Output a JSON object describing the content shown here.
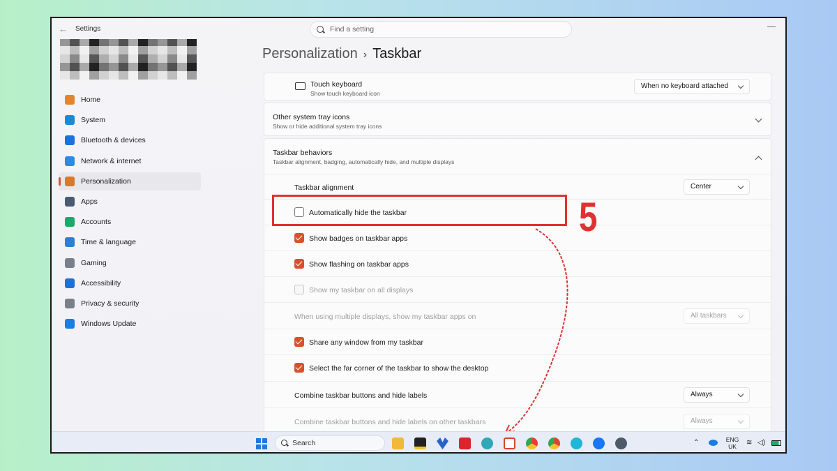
{
  "window": {
    "app_title": "Settings",
    "search_placeholder": "Find a setting",
    "breadcrumb_parent": "Personalization",
    "breadcrumb_sep": "›",
    "breadcrumb_current": "Taskbar"
  },
  "sidebar": {
    "items": [
      {
        "label": "Home",
        "icon": "home-icon",
        "color": "#e2852f"
      },
      {
        "label": "System",
        "icon": "system-icon",
        "color": "#1b8ad6"
      },
      {
        "label": "Bluetooth & devices",
        "icon": "bluetooth-icon",
        "color": "#1a73d8"
      },
      {
        "label": "Network & internet",
        "icon": "wifi-icon",
        "color": "#2a8be0"
      },
      {
        "label": "Personalization",
        "icon": "brush-icon",
        "color": "#d87a2a"
      },
      {
        "label": "Apps",
        "icon": "apps-icon",
        "color": "#4a5a73"
      },
      {
        "label": "Accounts",
        "icon": "person-icon",
        "color": "#1da96b"
      },
      {
        "label": "Time & language",
        "icon": "globe-clock-icon",
        "color": "#2b7fd4"
      },
      {
        "label": "Gaming",
        "icon": "gamepad-icon",
        "color": "#7a7f8a"
      },
      {
        "label": "Accessibility",
        "icon": "accessibility-icon",
        "color": "#1e72d6"
      },
      {
        "label": "Privacy & security",
        "icon": "shield-icon",
        "color": "#7a8089"
      },
      {
        "label": "Windows Update",
        "icon": "update-icon",
        "color": "#1a7de0"
      }
    ]
  },
  "settings": {
    "touch_keyboard": {
      "title": "Touch keyboard",
      "subtitle": "Show touch keyboard icon",
      "value": "When no keyboard attached"
    },
    "other_tray": {
      "title": "Other system tray icons",
      "subtitle": "Show or hide additional system tray icons"
    },
    "behaviors": {
      "title": "Taskbar behaviors",
      "subtitle": "Taskbar alignment, badging, automatically hide, and multiple displays",
      "alignment_label": "Taskbar alignment",
      "alignment_value": "Center",
      "auto_hide": "Automatically hide the taskbar",
      "badges": "Show badges on taskbar apps",
      "flashing": "Show flashing on taskbar apps",
      "all_displays": "Show my taskbar on all displays",
      "multi_display_label": "When using multiple displays, show my taskbar apps on",
      "multi_display_value": "All taskbars",
      "share_window": "Share any window from my taskbar",
      "far_corner": "Select the far corner of the taskbar to show the desktop",
      "combine_label": "Combine taskbar buttons and hide labels",
      "combine_value": "Always",
      "combine_other_label": "Combine taskbar buttons and hide labels on other taskbars",
      "combine_other_value": "Always"
    }
  },
  "annotation": {
    "step": "5",
    "color": "#e03131"
  },
  "taskbar": {
    "search_label": "Search",
    "lang_line1": "ENG",
    "lang_line2": "UK"
  }
}
